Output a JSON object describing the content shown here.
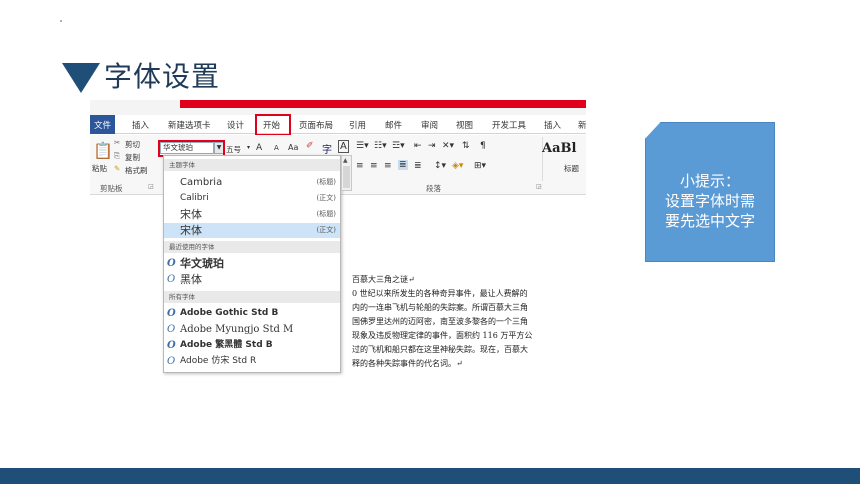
{
  "slide": {
    "title": "字体设置"
  },
  "menu": {
    "file": "文件",
    "items": [
      "插入",
      "新建选项卡",
      "设计",
      "开始",
      "页面布局",
      "引用",
      "邮件",
      "审阅",
      "视图",
      "开发工具",
      "插入",
      "新"
    ]
  },
  "ribbon": {
    "clipboard": {
      "paste": "粘贴",
      "cut": "剪切",
      "copy": "复制",
      "format_painter": "格式刷",
      "group_label": "剪贴板"
    },
    "font_box_value": "华文琥珀",
    "font_size": "五号",
    "grow": "A",
    "shrink": "A",
    "case": "Aa",
    "paragraph_label": "段落",
    "style_preview": "AaBl",
    "style_label": "标题"
  },
  "dropdown": {
    "theme_header": "主题字体",
    "theme_fonts": [
      {
        "name": "Cambria",
        "tag": "(标题)"
      },
      {
        "name": "Calibri",
        "tag": "(正文)"
      },
      {
        "name": "宋体",
        "tag": "(标题)"
      },
      {
        "name": "宋体",
        "tag": "(正文)"
      }
    ],
    "recent_header": "最近使用的字体",
    "recent_fonts": [
      "华文琥珀",
      "黑体"
    ],
    "all_header": "所有字体",
    "all_fonts": [
      "Adobe Gothic Std B",
      "Adobe Myungjo Std M",
      "Adobe 繁黑體 Std B",
      "Adobe 仿宋 Std R"
    ],
    "o_glyph": "O"
  },
  "document": {
    "lines": [
      "百慕大三角之谜↵",
      "0 世纪以来所发生的各种奇异事件，最让人费解的",
      "内的一连串飞机与轮船的失踪案。所谓百慕大三角",
      "国佛罗里达州的迈阿密，南至波多黎各的一个三角",
      "现象及违反物理定律的事件，面积约 116 万平方公",
      "过的飞机和船只都在这里神秘失踪。现在，百慕大",
      "释的各种失踪事件的代名词。↵"
    ]
  },
  "tip": {
    "line1": "小提示：",
    "line2": "设置字体时需",
    "line3": "要先选中文字"
  },
  "colors": {
    "accent": "#1f4e79",
    "highlight": "#e0001b",
    "tip_bg": "#5b9bd5"
  }
}
